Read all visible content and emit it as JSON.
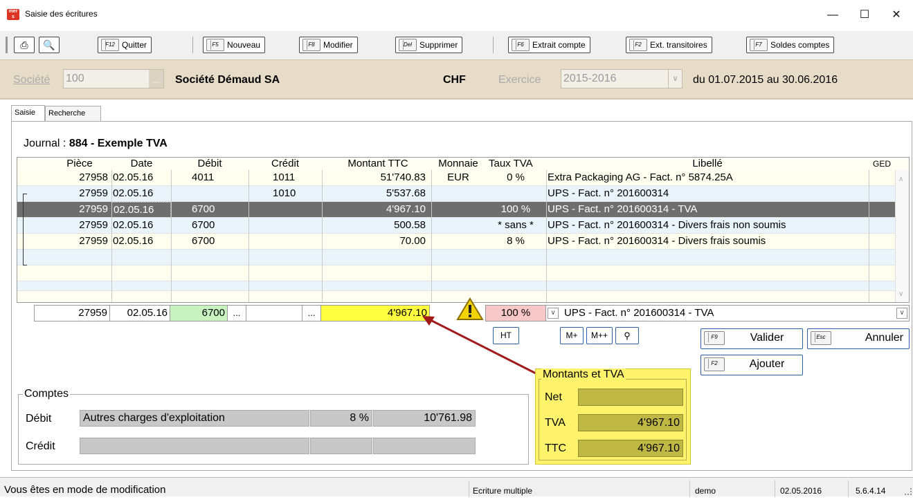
{
  "window": {
    "title": "Saisie des écritures",
    "icon_text": "mer s"
  },
  "toolbar": {
    "quitter": {
      "key": "F12",
      "label": "Quitter"
    },
    "nouveau": {
      "key": "F5",
      "label": "Nouveau"
    },
    "modifier": {
      "key": "F8",
      "label": "Modifier"
    },
    "supprimer": {
      "key": "Del",
      "label": "Supprimer"
    },
    "extrait": {
      "key": "F6",
      "label": "Extrait compte"
    },
    "transitoires": {
      "key": "F2",
      "label": "Ext. transitoires"
    },
    "soldes": {
      "key": "F7",
      "label": "Soldes comptes"
    }
  },
  "company": {
    "societe_label": "Société",
    "societe_value": "100",
    "societe_name": "Société Démaud SA",
    "currency": "CHF",
    "exercice_label": "Exercice",
    "exercice_value": "2015-2016",
    "period": "du 01.07.2015 au 30.06.2016"
  },
  "tabs": [
    "Saisie",
    "Recherche"
  ],
  "journal": {
    "label": "Journal :",
    "value": "884 - Exemple TVA"
  },
  "grid": {
    "headers": {
      "piece": "Pièce",
      "date": "Date",
      "debit": "Débit",
      "credit": "Crédit",
      "montant": "Montant TTC",
      "monnaie": "Monnaie",
      "taux": "Taux TVA",
      "libelle": "Libellé",
      "ged": "GED"
    },
    "rows": [
      {
        "piece": "27958",
        "date": "02.05.16",
        "debit": "4011",
        "credit": "1011",
        "montant": "51'740.83",
        "monnaie": "EUR",
        "taux": "0 %",
        "libelle": "Extra Packaging AG - Fact. n° 5874.25A"
      },
      {
        "piece": "27959",
        "date": "02.05.16",
        "debit": "",
        "credit": "1010",
        "montant": "5'537.68",
        "monnaie": "",
        "taux": "",
        "libelle": "UPS - Fact. n° 201600314"
      },
      {
        "piece": "27959",
        "date": "02.05.16",
        "debit": "6700",
        "credit": "",
        "montant": "4'967.10",
        "monnaie": "",
        "taux": "100 %",
        "libelle": "UPS - Fact. n° 201600314 - TVA"
      },
      {
        "piece": "27959",
        "date": "02.05.16",
        "debit": "6700",
        "credit": "",
        "montant": "500.58",
        "monnaie": "",
        "taux": "* sans *",
        "libelle": "UPS - Fact. n° 201600314 - Divers frais non soumis"
      },
      {
        "piece": "27959",
        "date": "02.05.16",
        "debit": "6700",
        "credit": "",
        "montant": "70.00",
        "monnaie": "",
        "taux": "8 %",
        "libelle": "UPS - Fact. n° 201600314 - Divers frais soumis"
      }
    ]
  },
  "entry": {
    "piece": "27959",
    "date": "02.05.16",
    "debit": "6700",
    "credit": "",
    "montant": "4'967.10",
    "taux": "100 %",
    "libelle": "UPS - Fact. n° 201600314 - TVA",
    "dots": "..."
  },
  "buttons": {
    "ht": "HT",
    "mplus": "M+",
    "mplusplus": "M++",
    "valider_key": "F9",
    "valider": "Valider",
    "annuler_key": "Esc",
    "annuler": "Annuler",
    "ajouter_key": "F2",
    "ajouter": "Ajouter"
  },
  "comptes": {
    "title": "Comptes",
    "debit_label": "Débit",
    "debit_name": "Autres charges d'exploitation",
    "debit_rate": "8 %",
    "debit_balance": "10'761.98",
    "credit_label": "Crédit"
  },
  "tva_box": {
    "title": "Montants et TVA",
    "net_label": "Net",
    "net_value": "",
    "tva_label": "TVA",
    "tva_value": "4'967.10",
    "ttc_label": "TTC",
    "ttc_value": "4'967.10"
  },
  "status": {
    "mode": "Vous êtes en mode de modification",
    "type": "Ecriture multiple",
    "user": "demo",
    "date": "02.05.2016",
    "version": "5.6.4.14"
  },
  "colors": {
    "selected_row": "#6e6e6e",
    "alt_row": "#eaf4fb",
    "debit_green": "#c8f3c0",
    "highlight_yellow": "#ffff40",
    "tva_red": "#f8c8c8",
    "box_yellow": "#fef36a",
    "arrow": "#a01a1a"
  }
}
